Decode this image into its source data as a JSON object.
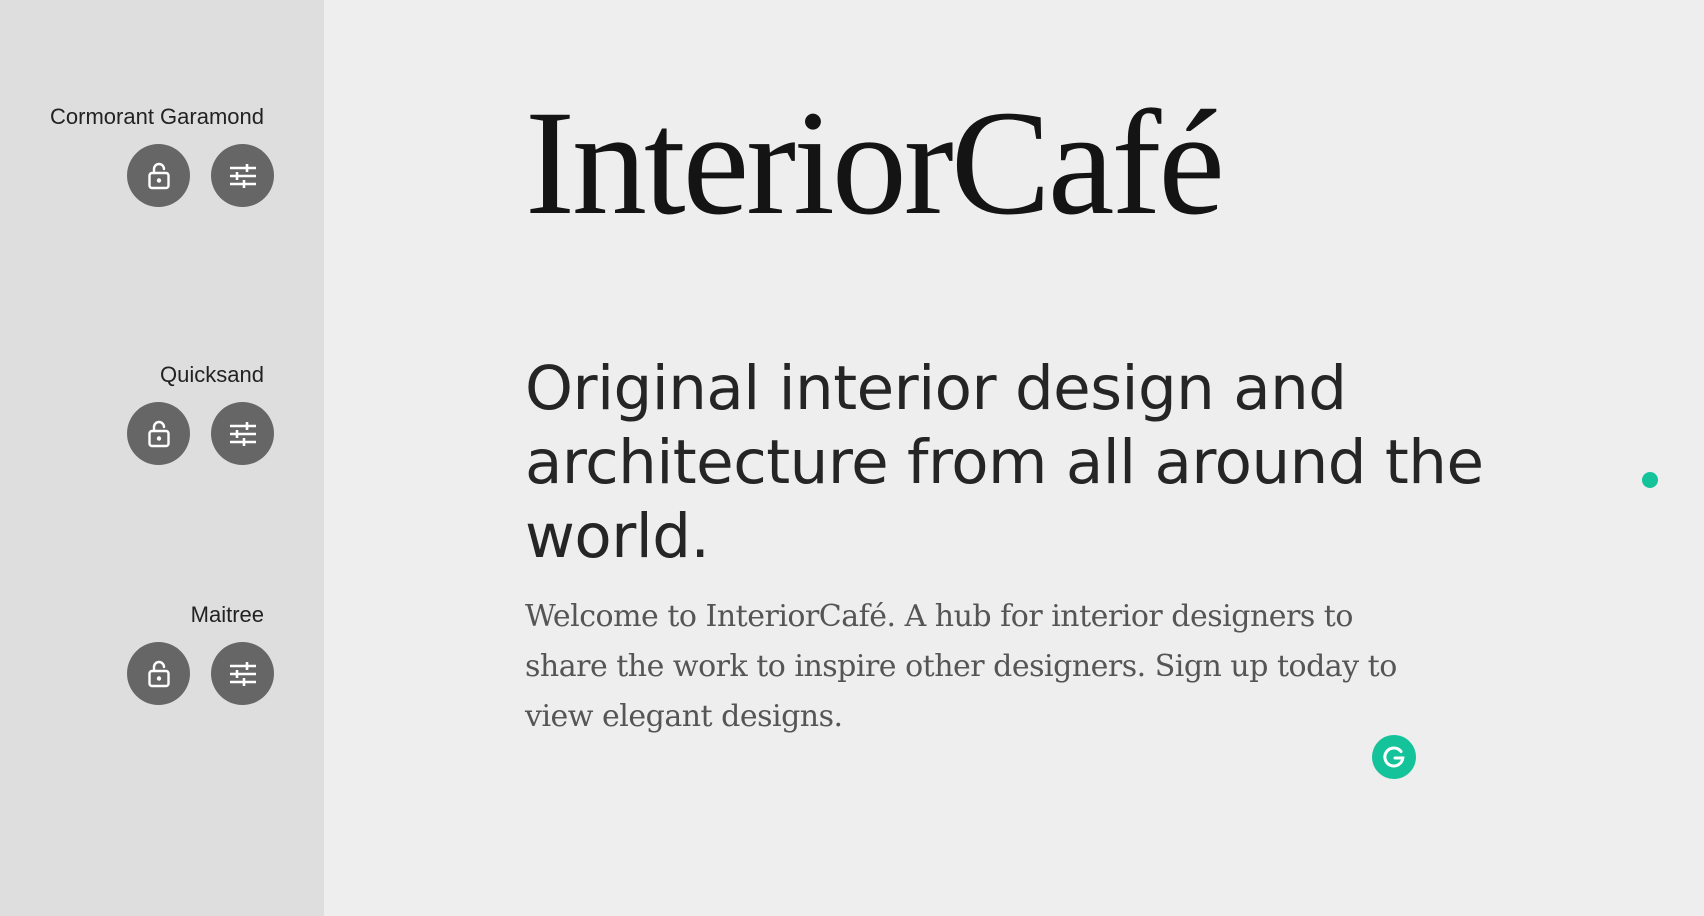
{
  "sidebar": {
    "font_groups": [
      {
        "name": "Cormorant Garamond",
        "lock_icon": "lock-open-icon",
        "settings_icon": "sliders-icon"
      },
      {
        "name": "Quicksand",
        "lock_icon": "lock-open-icon",
        "settings_icon": "sliders-icon"
      },
      {
        "name": "Maitree",
        "lock_icon": "lock-open-icon",
        "settings_icon": "sliders-icon"
      }
    ]
  },
  "main": {
    "title": "InteriorCafé",
    "subtitle": "Original interior design and architecture from all around the world.",
    "body": "Welcome to InteriorCafé. A hub for interior designers to share the work to inspire other designers. Sign up today to view elegant designs."
  },
  "widgets": {
    "grammarly_icon": "grammarly-icon",
    "cursor_indicator": "cursor-dot"
  },
  "colors": {
    "page_background": "#eeeeee",
    "sidebar_background": "#dedede",
    "button_background": "#666666",
    "accent_green": "#15c39a"
  }
}
